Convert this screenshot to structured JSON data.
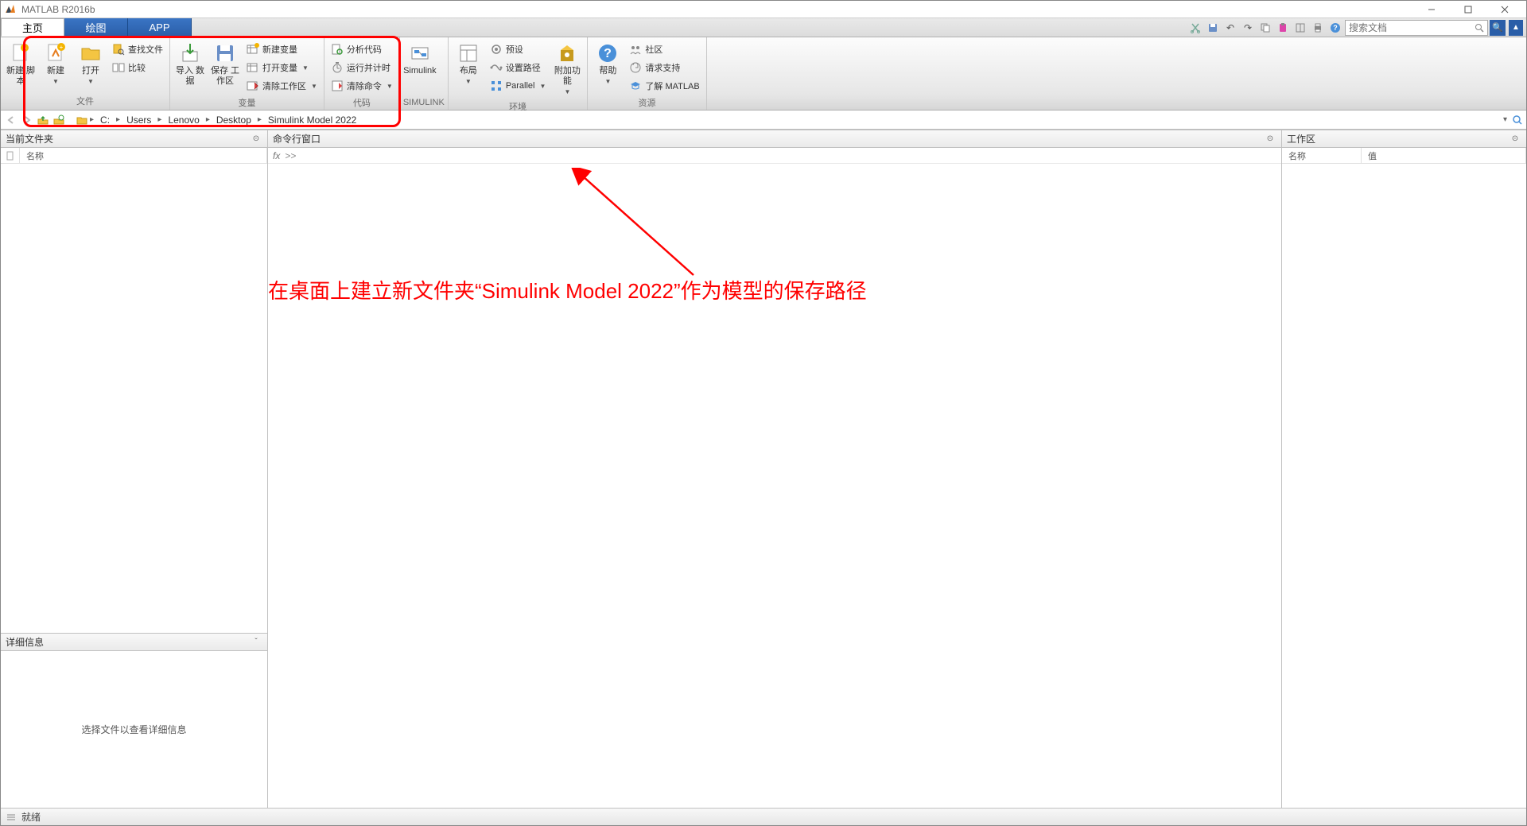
{
  "titlebar": {
    "title": "MATLAB R2016b"
  },
  "tabs": {
    "home": "主页",
    "plots": "绘图",
    "apps": "APP"
  },
  "qat": {
    "search_placeholder": "搜索文档"
  },
  "ribbon": {
    "file": {
      "label": "文件",
      "new_script": "新建\n脚本",
      "new": "新建",
      "open": "打开",
      "find_files": "查找文件",
      "compare": "比较"
    },
    "var": {
      "label": "变量",
      "import": "导入\n数据",
      "save_ws": "保存\n工作区",
      "new_var": "新建变量",
      "open_var": "打开变量",
      "clear_ws": "清除工作区"
    },
    "code": {
      "label": "代码",
      "analyze": "分析代码",
      "run_time": "运行并计时",
      "clear_cmd": "清除命令"
    },
    "simulink": {
      "label": "SIMULINK",
      "btn": "Simulink"
    },
    "env": {
      "label": "环境",
      "layout": "布局",
      "prefs": "预设",
      "set_path": "设置路径",
      "parallel": "Parallel",
      "addons": "附加功能"
    },
    "res": {
      "label": "资源",
      "help": "帮助",
      "community": "社区",
      "support": "请求支持",
      "learn": "了解 MATLAB"
    }
  },
  "address": {
    "crumbs": [
      "C:",
      "Users",
      "Lenovo",
      "Desktop",
      "Simulink Model 2022"
    ]
  },
  "panels": {
    "current_folder": "当前文件夹",
    "name_col": "名称",
    "details": "详细信息",
    "details_msg": "选择文件以查看详细信息",
    "command_window": "命令行窗口",
    "prompt": ">>",
    "workspace": "工作区",
    "ws_name": "名称",
    "ws_value": "值"
  },
  "annotation": {
    "text": "在桌面上建立新文件夹“Simulink Model 2022”作为模型的保存路径"
  },
  "status": {
    "ready": "就绪"
  }
}
